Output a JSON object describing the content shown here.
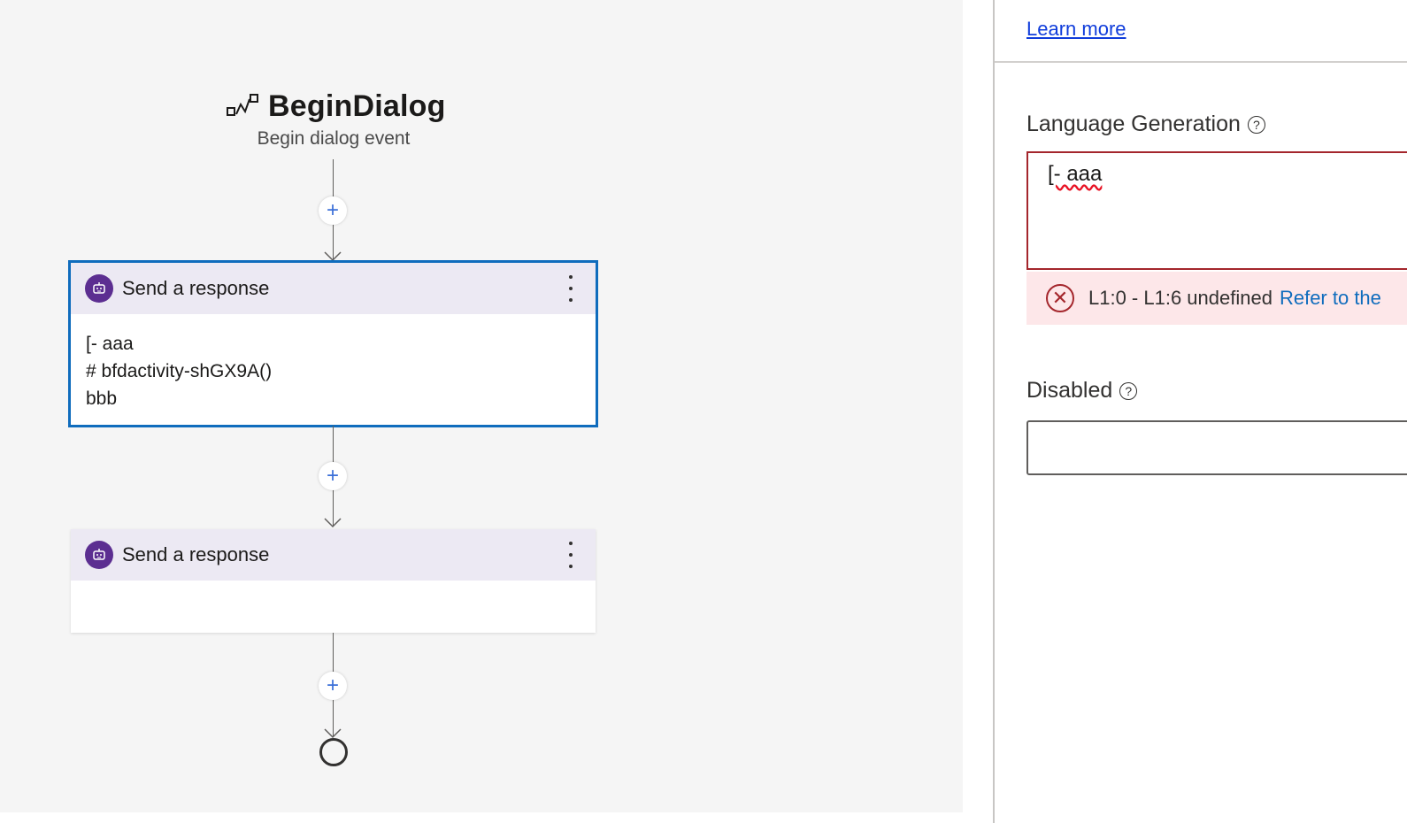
{
  "canvas": {
    "trigger": {
      "icon": "trigger-icon",
      "title": "BeginDialog",
      "subtitle": "Begin dialog event"
    },
    "add_button_label": "+",
    "nodes": [
      {
        "icon": "bot-icon",
        "title": "Send a response",
        "selected": true,
        "lines": [
          "[- aaa",
          "# bfdactivity-shGX9A()",
          "bbb"
        ]
      },
      {
        "icon": "bot-icon",
        "title": "Send a response",
        "selected": false,
        "lines": []
      }
    ]
  },
  "panel": {
    "learn_more": "Learn more",
    "language_generation": {
      "label": "Language Generation",
      "help_icon": "?",
      "value": "[- aaa",
      "error": {
        "icon": "error-circle-icon",
        "message": "L1:0 - L1:6 undefined",
        "link": "Refer to the"
      }
    },
    "disabled": {
      "label": "Disabled",
      "help_icon": "?",
      "value": ""
    }
  },
  "colors": {
    "accent": "#0f6cbd",
    "bot_badge": "#5c2e91",
    "card_header": "#ece9f3",
    "error": "#a4262c",
    "error_bg": "#fde7e9",
    "link": "#0f3cdb"
  }
}
